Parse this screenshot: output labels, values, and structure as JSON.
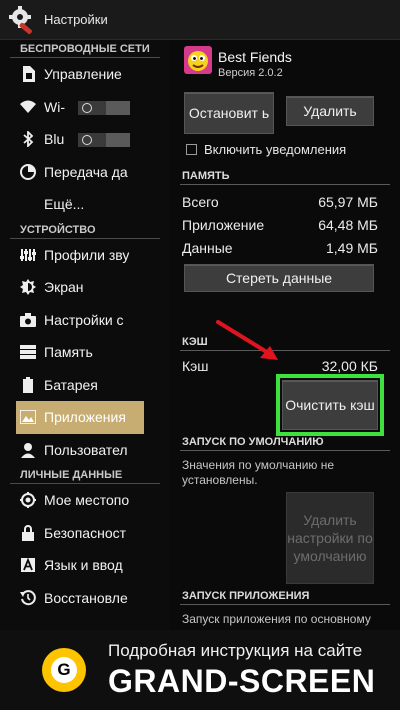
{
  "titlebar": {
    "title": "Настройки"
  },
  "sidebar": {
    "sections": [
      {
        "header": "БЕСПРОВОДНЫЕ СЕТИ",
        "items": [
          {
            "label": "Управление",
            "icon": "sim-icon"
          },
          {
            "label": "Wi-",
            "icon": "wifi-icon",
            "toggle": "off"
          },
          {
            "label": "Blu",
            "icon": "bluetooth-icon",
            "toggle": "off"
          },
          {
            "label": "Передача да",
            "icon": "data-usage-icon"
          },
          {
            "label": "Ещё...",
            "icon": ""
          }
        ]
      },
      {
        "header": "УСТРОЙСТВО",
        "items": [
          {
            "label": "Профили зву",
            "icon": "sound-icon"
          },
          {
            "label": "Экран",
            "icon": "brightness-icon"
          },
          {
            "label": "Настройки с",
            "icon": "camera-icon"
          },
          {
            "label": "Память",
            "icon": "storage-icon"
          },
          {
            "label": "Батарея",
            "icon": "battery-icon"
          },
          {
            "label": "Приложения",
            "icon": "apps-icon",
            "selected": true
          },
          {
            "label": "Пользовател",
            "icon": "user-icon"
          }
        ]
      },
      {
        "header": "ЛИЧНЫЕ ДАННЫЕ",
        "items": [
          {
            "label": "Мое местопо",
            "icon": "location-icon"
          },
          {
            "label": "Безопасност",
            "icon": "lock-icon"
          },
          {
            "label": "Язык и ввод",
            "icon": "language-icon"
          },
          {
            "label": "Восстановле",
            "icon": "restore-icon"
          }
        ]
      }
    ]
  },
  "app": {
    "name": "Best Fiends",
    "version": "Версия 2.0.2",
    "stop_label": "Остановит ь",
    "uninstall_label": "Удалить",
    "notifications_label": "Включить уведомления",
    "memory": {
      "header": "ПАМЯТЬ",
      "rows": [
        {
          "label": "Всего",
          "value": "65,97 МБ"
        },
        {
          "label": "Приложение",
          "value": "64,48 МБ"
        },
        {
          "label": "Данные",
          "value": "1,49 МБ"
        }
      ],
      "clear_data_label": "Стереть данные"
    },
    "cache": {
      "header": "КЭШ",
      "label": "Кэш",
      "value": "32,00 КБ",
      "clear_cache_label": "Очистить кэш"
    },
    "launch_default": {
      "header": "ЗАПУСК ПО УМОЛЧАНИЮ",
      "hint": "Значения по умолчанию не установлены.",
      "reset_label": "Удалить настройки по умолчанию"
    },
    "launch_app": {
      "header": "ЗАПУСК ПРИЛОЖЕНИЯ",
      "hint": "Запуск приложения по основному"
    }
  },
  "banner": {
    "line1": "Подробная инструкция на сайте",
    "line2": "GRAND-SCREEN",
    "logo_letter": "G"
  },
  "colors": {
    "selected": "#c8ad72",
    "highlight": "#3ee23e",
    "arrow": "#e0141e",
    "logo": "#ffc400"
  }
}
